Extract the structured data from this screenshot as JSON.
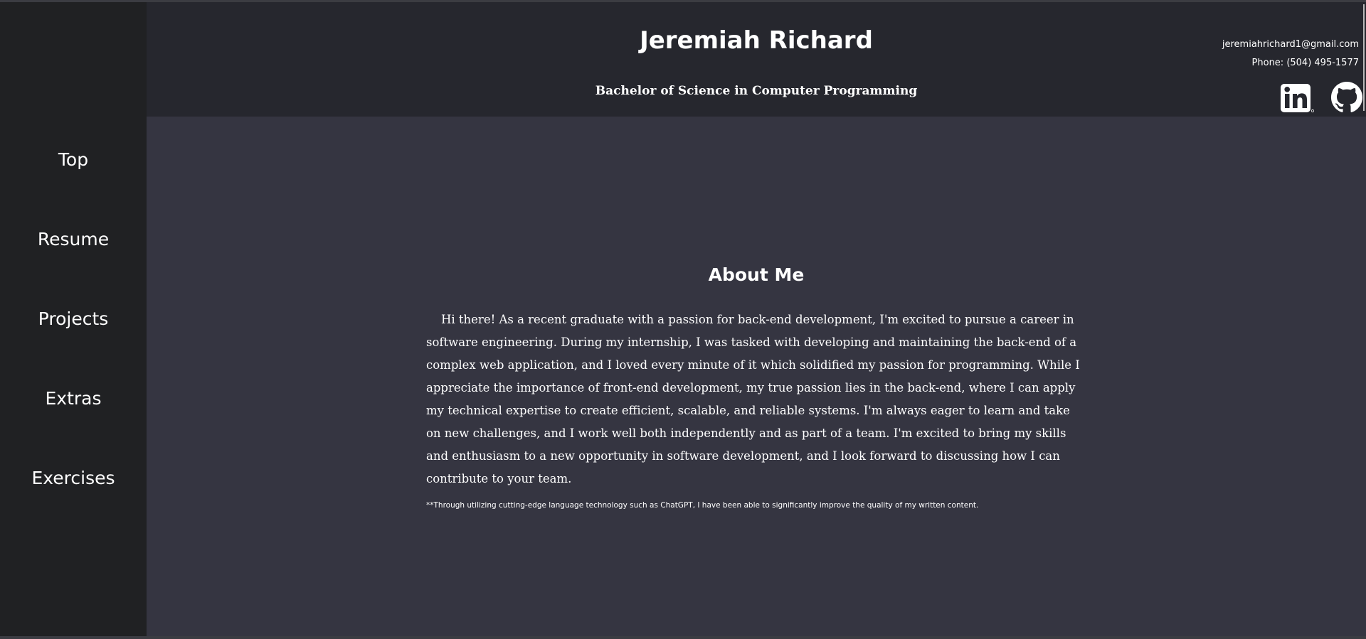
{
  "header": {
    "name": "Jeremiah Richard",
    "degree": "Bachelor of Science in Computer Programming",
    "email": "jeremiahrichard1@gmail.com",
    "phone": "Phone: (504) 495-1577",
    "social": [
      {
        "name": "linkedin",
        "icon": "linkedin-icon"
      },
      {
        "name": "github",
        "icon": "github-icon"
      }
    ]
  },
  "sidebar": {
    "items": [
      {
        "label": "Top"
      },
      {
        "label": "Resume"
      },
      {
        "label": "Projects"
      },
      {
        "label": "Extras"
      },
      {
        "label": "Exercises"
      }
    ]
  },
  "about": {
    "title": "About Me",
    "body": "Hi there! As a recent graduate with a passion for back-end development, I'm excited to pursue a career in software engineering. During my internship, I was tasked with developing and maintaining the back-end of a complex web application, and I loved every minute of it which solidified my passion for programming. While I appreciate the importance of front-end development, my true passion lies in the back-end, where I can apply my technical expertise to create efficient, scalable, and reliable systems. I'm always eager to learn and take on new challenges, and I work well both independently and as part of a team. I'm excited to bring my skills and enthusiasm to a new opportunity in software development, and I look forward to discussing how I can contribute to your team.",
    "note": "**Through utilizing cutting-edge language technology such as ChatGPT, I have been able to significantly improve the quality of my written content."
  },
  "colors": {
    "sidebar_bg": "#202123",
    "header_bg": "#26272e",
    "main_bg": "#353541",
    "text": "#ffffff"
  }
}
